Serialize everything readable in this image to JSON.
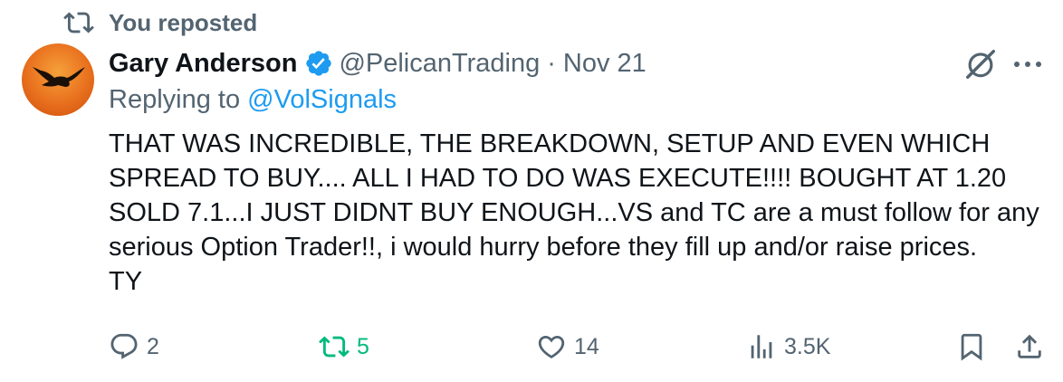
{
  "repost_banner": {
    "text": "You reposted",
    "icon": "repost-icon"
  },
  "tweet": {
    "author": {
      "name": "Gary Anderson",
      "verified_icon": "verified-badge-icon",
      "handle": "@PelicanTrading",
      "separator": "·",
      "date": "Nov 21",
      "avatar": "pelican-avatar"
    },
    "replying_to": {
      "prefix": "Replying to",
      "handle": "@VolSignals"
    },
    "text_lines": [
      "THAT WAS INCREDIBLE, THE BREAKDOWN, SETUP AND EVEN WHICH",
      "SPREAD TO BUY.... ALL I HAD TO DO WAS EXECUTE!!!!  BOUGHT AT 1.20",
      "SOLD 7.1...I JUST DIDNT BUY ENOUGH...VS and TC are a must follow for any",
      "serious Option Trader!!, i would hurry before they fill up and/or raise prices.",
      "TY"
    ],
    "actions": {
      "reply": {
        "icon": "reply-icon",
        "count": "2"
      },
      "retweet": {
        "icon": "retweet-icon",
        "count": "5",
        "active_color": "#00ba7c"
      },
      "like": {
        "icon": "heart-icon",
        "count": "14"
      },
      "views": {
        "icon": "views-icon",
        "count": "3.5K"
      },
      "bookmark": {
        "icon": "bookmark-icon"
      },
      "share": {
        "icon": "share-icon"
      }
    },
    "top_right": {
      "grok_icon": "grok-icon",
      "more_icon": "more-icon"
    }
  },
  "colors": {
    "text": "#0f1419",
    "secondary": "#536471",
    "link": "#1d9bf0",
    "retweet_active": "#00ba7c",
    "avatar_bg": "#e86a1a"
  }
}
